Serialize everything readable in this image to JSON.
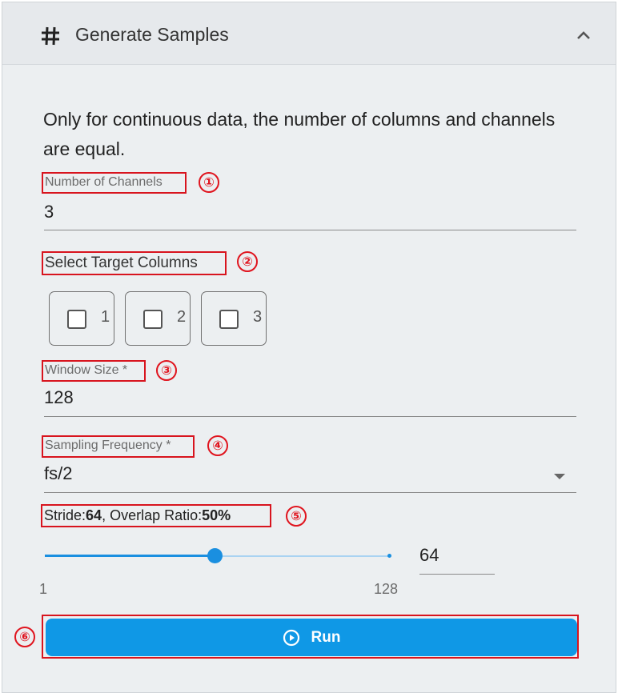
{
  "header": {
    "title": "Generate Samples",
    "icon": "hash-icon",
    "toggle_icon": "chevron-up-icon"
  },
  "description": "Only for continuous data, the number of columns and channels are equal.",
  "channels": {
    "label": "Number of Channels",
    "value": "3",
    "marker": "①"
  },
  "target_columns": {
    "label": "Select Target Columns",
    "marker": "②",
    "options": [
      "1",
      "2",
      "3"
    ],
    "checked": [
      false,
      false,
      false
    ]
  },
  "window_size": {
    "label": "Window Size *",
    "value": "128",
    "marker": "③"
  },
  "sampling_frequency": {
    "label": "Sampling Frequency *",
    "value": "fs/2",
    "marker": "④"
  },
  "stride": {
    "stride_label": "Stride:",
    "stride_value": "64",
    "overlap_label": ", Overlap Ratio:",
    "overlap_value": "50%",
    "marker": "⑤",
    "slider_min": "1",
    "slider_max": "128",
    "slider_value": "64"
  },
  "run": {
    "label": "Run",
    "marker": "⑥",
    "icon": "play-circle-icon"
  },
  "colors": {
    "accent": "#0f98e6",
    "annotation": "#d8141e",
    "panel_bg": "#eceff1"
  }
}
